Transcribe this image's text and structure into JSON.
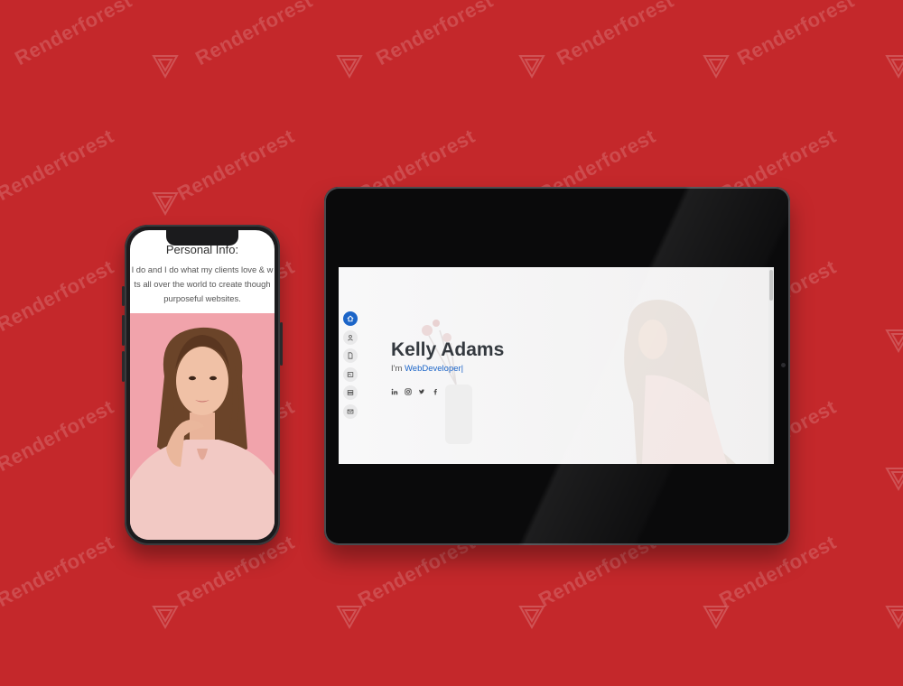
{
  "watermark": {
    "text": "Renderforest"
  },
  "phone": {
    "title": "Personal Info:",
    "intro_lines": [
      "I do and I do what my clients love & w",
      "ts all over the world to create though",
      "purposeful websites."
    ]
  },
  "tablet": {
    "hero": {
      "name": "Kelly Adams",
      "prefix": "I'm",
      "role": "WebDeveloper|"
    },
    "nav_icons": [
      "home-icon",
      "user-icon",
      "document-icon",
      "portfolio-icon",
      "services-icon",
      "mail-icon"
    ],
    "social_icons": [
      "linkedin-icon",
      "instagram-icon",
      "twitter-icon",
      "facebook-icon"
    ]
  },
  "colors": {
    "background": "#c4282b",
    "accent": "#1c65c8",
    "phone_photo_bg": "#f1a3ab",
    "heading": "#34393f"
  }
}
